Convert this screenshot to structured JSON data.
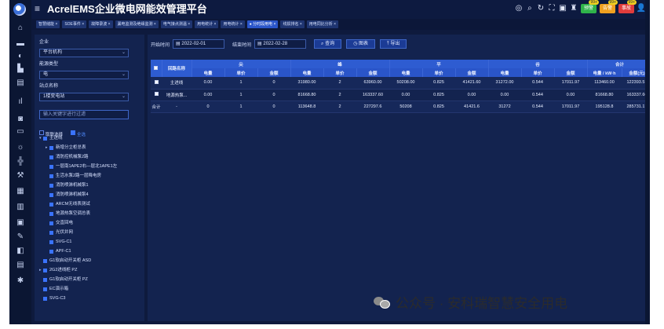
{
  "header": {
    "title": "AcrelEMS企业微电网能效管理平台",
    "badges": [
      {
        "label": "预警",
        "count": "99+",
        "color": "#2fb34a"
      },
      {
        "label": "告警",
        "count": "99+",
        "color": "#f0a020"
      },
      {
        "label": "事故",
        "count": "99+",
        "color": "#e03c3c"
      }
    ]
  },
  "tabs": [
    {
      "label": "智慧储能 ×"
    },
    {
      "label": "SOE事件 ×"
    },
    {
      "label": "故障录波 ×"
    },
    {
      "label": "漏电监测及绝缘监测 ×"
    },
    {
      "label": "电气接点测温 ×"
    },
    {
      "label": "用电统计 ×"
    },
    {
      "label": "用电统计 ×"
    },
    {
      "label": "● 分时段用电 ×",
      "active": true
    },
    {
      "label": "线损排名 ×"
    },
    {
      "label": "用电同比分析 ×"
    }
  ],
  "left": {
    "company_label": "企业",
    "company_value": "平台机构",
    "energy_label": "能源类型",
    "energy_value": "电",
    "station_label": "站点名称",
    "station_value": "1楼变电站",
    "search_placeholder": "输入关键字进行过滤",
    "opt_cascade": "取联选择",
    "opt_all": "全选",
    "tree": [
      {
        "label": "主进线",
        "depth": 0,
        "toggle": "▾"
      },
      {
        "label": "新增分立柜总表",
        "depth": 1,
        "toggle": "▸"
      },
      {
        "label": "消防控机械泵2路",
        "depth": 1,
        "toggle": ""
      },
      {
        "label": "一层南1APE2右—层北1APE1左",
        "depth": 1,
        "toggle": ""
      },
      {
        "label": "生活水泵2路一层降电房",
        "depth": 1,
        "toggle": ""
      },
      {
        "label": "消防喷淋机械泵1",
        "depth": 1,
        "toggle": ""
      },
      {
        "label": "消防喷淋机械泵4",
        "depth": 1,
        "toggle": ""
      },
      {
        "label": "ARCM无线表测试",
        "depth": 1,
        "toggle": ""
      },
      {
        "label": "地源热泵空调总表",
        "depth": 1,
        "toggle": ""
      },
      {
        "label": "交直回电",
        "depth": 1,
        "toggle": ""
      },
      {
        "label": "光伏并网",
        "depth": 1,
        "toggle": ""
      },
      {
        "label": "SVG-C1",
        "depth": 1,
        "toggle": ""
      },
      {
        "label": "APF-C1",
        "depth": 1,
        "toggle": ""
      },
      {
        "label": "G1软启动开关柜 ASD",
        "depth": 0,
        "toggle": ""
      },
      {
        "label": "2G2进线柜 PZ",
        "depth": 0,
        "toggle": "▸"
      },
      {
        "label": "G1软启动开关柜 PZ",
        "depth": 0,
        "toggle": ""
      },
      {
        "label": "EC演示箱",
        "depth": 0,
        "toggle": ""
      },
      {
        "label": "SVG-C3",
        "depth": 0,
        "toggle": ""
      }
    ]
  },
  "toolbar": {
    "start_label": "开始时间",
    "start_value": "2022-02-01",
    "end_label": "结束时间",
    "end_value": "2022-02-28",
    "query": "查询",
    "chart": "图表",
    "export": "导出"
  },
  "table": {
    "name_header": "回路名称",
    "groups": [
      "尖",
      "峰",
      "平",
      "谷",
      "合计"
    ],
    "sub_headers": [
      "电量",
      "单价",
      "金额",
      "电量",
      "单价",
      "金额",
      "电量",
      "单价",
      "金额",
      "电量",
      "单价",
      "金额",
      "电量 / kW·h",
      "金额(元)"
    ],
    "rows": [
      {
        "check": true,
        "name": "主进线",
        "cells": [
          "0.00",
          "1",
          "0",
          "31980.00",
          "2",
          "63960.00",
          "50208.00",
          "0.825",
          "41421.60",
          "31272.00",
          "0.544",
          "17011.97",
          "113460.00",
          "122393.57"
        ]
      },
      {
        "check": true,
        "name": "地源热泵...",
        "cells": [
          "0.00",
          "1",
          "0",
          "81668.80",
          "2",
          "163337.60",
          "0.00",
          "0.825",
          "0.00",
          "0.00",
          "0.544",
          "0.00",
          "81668.80",
          "163337.60"
        ]
      },
      {
        "check": false,
        "name": "合计",
        "name2": "-",
        "cells": [
          "0",
          "1",
          "0",
          "113648.8",
          "2",
          "227297.6",
          "50208",
          "0.825",
          "41421.6",
          "31272",
          "0.544",
          "17011.97",
          "195128.8",
          "285731.17"
        ]
      }
    ]
  },
  "watermark": "公众号 · 安科瑞智慧安全用电"
}
